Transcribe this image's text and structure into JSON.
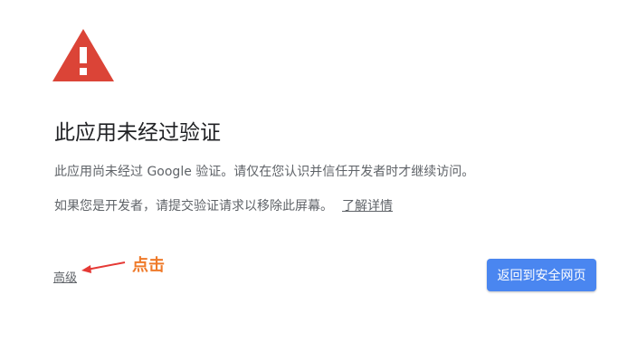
{
  "warning": {
    "icon": "warning-triangle-icon",
    "color": "#db4437"
  },
  "title": "此应用未经过验证",
  "body": {
    "line1": "此应用尚未经过 Google 验证。请仅在您认识并信任开发者时才继续访问。",
    "line2": "如果您是开发者，请提交验证请求以移除此屏幕。",
    "learn_more": "了解详情"
  },
  "advanced_link": "高级",
  "annotation": {
    "text": "点击",
    "color": "#ef7a2a",
    "arrow_color": "#e53935"
  },
  "back_button": {
    "label": "返回到安全网页",
    "color": "#4a86f0"
  }
}
